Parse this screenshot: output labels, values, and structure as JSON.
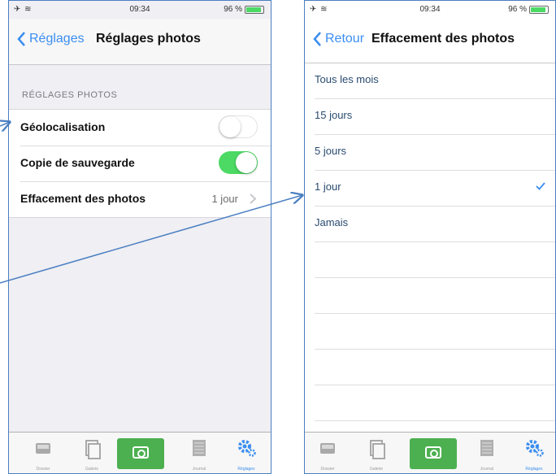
{
  "left_screen": {
    "status": {
      "left_icons": "✈ ≋",
      "time": "09:34",
      "battery": "96 %"
    },
    "nav": {
      "back_label": "Réglages",
      "title": "Réglages photos"
    },
    "section_header": "RÉGLAGES PHOTOS",
    "rows": [
      {
        "label": "Géolocalisation",
        "toggle": "off"
      },
      {
        "label": "Copie de sauvegarde",
        "toggle": "on"
      },
      {
        "label": "Effacement des photos",
        "value": "1 jour"
      }
    ]
  },
  "right_screen": {
    "status": {
      "left_icons": "✈ ≋",
      "time": "09:34",
      "battery": "96 %"
    },
    "nav": {
      "back_label": "Retour",
      "title": "Effacement des photos"
    },
    "options": [
      {
        "label": "Tous les mois",
        "selected": false
      },
      {
        "label": "15 jours",
        "selected": false
      },
      {
        "label": "5 jours",
        "selected": false
      },
      {
        "label": "1 jour",
        "selected": true
      },
      {
        "label": "Jamais",
        "selected": false
      }
    ]
  },
  "tabbar": {
    "items": [
      {
        "label": "Dossier",
        "icon": "inbox-icon"
      },
      {
        "label": "Galerie",
        "icon": "gallery-icon"
      },
      {
        "label": "",
        "icon": "camera-icon"
      },
      {
        "label": "Journal",
        "icon": "journal-icon"
      },
      {
        "label": "Réglages",
        "icon": "gear-icon"
      }
    ]
  },
  "colors": {
    "accent": "#3b8ef0",
    "toggle_on": "#4cd964",
    "camera_tab": "#4cb050",
    "annotation_arrow": "#4a7fc1"
  }
}
